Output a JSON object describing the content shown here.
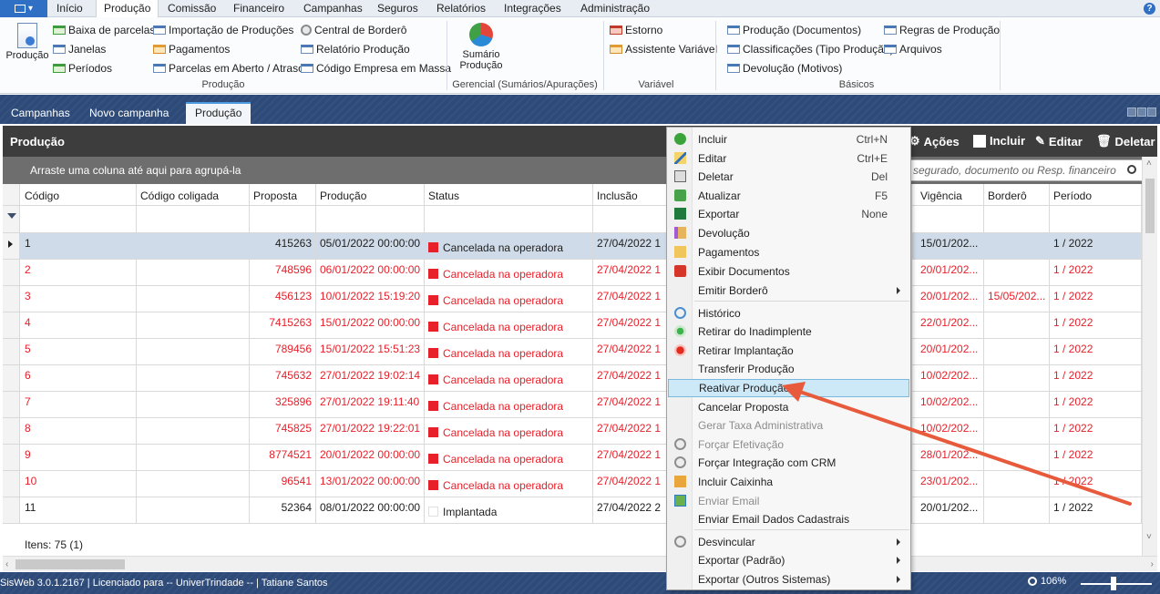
{
  "menubar": {
    "tabs": [
      "Início",
      "Produção",
      "Comissão",
      "Financeiro",
      "Campanhas",
      "Seguros",
      "Relatórios",
      "Integrações",
      "Administração"
    ],
    "active_tab": "Produção"
  },
  "ribbon": {
    "producao_big": "Produção",
    "col1": [
      "Baixa de parcelas",
      "Janelas",
      "Períodos"
    ],
    "col2": [
      "Importação de Produções",
      "Pagamentos",
      "Parcelas em Aberto / Atraso"
    ],
    "col3": [
      "Central de Borderô",
      "Relatório Produção",
      "Código Empresa em Massa"
    ],
    "group_producao": "Produção",
    "sumario_line1": "Sumário",
    "sumario_line2": "Produção",
    "group_gerencial": "Gerencial (Sumários/Apurações)",
    "variavel_items": [
      "Estorno",
      "Assistente Variável"
    ],
    "group_variavel": "Variável",
    "basicos_col1": [
      "Produção (Documentos)",
      "Classificações (Tipo Produção)",
      "Devolução (Motivos)"
    ],
    "basicos_col2": [
      "Regras de Produção",
      "Arquivos"
    ],
    "group_basicos": "Básicos"
  },
  "doc_tabs": [
    "Campanhas",
    "Novo campanha",
    "Produção"
  ],
  "panel": {
    "title": "Produção",
    "acoes": "Ações",
    "incluir": "Incluir",
    "editar": "Editar",
    "deletar": "Deletar"
  },
  "groupbar": {
    "hint": "Arraste uma coluna até aqui para agrupá-la",
    "search_placeholder": "segurado, documento ou Resp. financeiro"
  },
  "grid": {
    "columns": [
      "Código",
      "Código coligada",
      "Proposta",
      "Produção",
      "Status",
      "Inclusão",
      "Vigência",
      "Borderô",
      "Período"
    ],
    "rows": [
      {
        "codigo": "1",
        "proposta": "415263",
        "producao": "05/01/2022 00:00:00",
        "status": "Cancelada na operadora",
        "inclusao": "27/04/2022 1",
        "vigencia": "15/01/202...",
        "bordero": "",
        "periodo": "1 / 2022"
      },
      {
        "codigo": "2",
        "proposta": "748596",
        "producao": "06/01/2022 00:00:00",
        "status": "Cancelada na operadora",
        "inclusao": "27/04/2022 1",
        "vigencia": "20/01/202...",
        "bordero": "",
        "periodo": "1 / 2022"
      },
      {
        "codigo": "3",
        "proposta": "456123",
        "producao": "10/01/2022 15:19:20",
        "status": "Cancelada na operadora",
        "inclusao": "27/04/2022 1",
        "vigencia": "20/01/202...",
        "bordero": "15/05/202...",
        "periodo": "1 / 2022"
      },
      {
        "codigo": "4",
        "proposta": "7415263",
        "producao": "15/01/2022 00:00:00",
        "status": "Cancelada na operadora",
        "inclusao": "27/04/2022 1",
        "vigencia": "22/01/202...",
        "bordero": "",
        "periodo": "1 / 2022"
      },
      {
        "codigo": "5",
        "proposta": "789456",
        "producao": "15/01/2022 15:51:23",
        "status": "Cancelada na operadora",
        "inclusao": "27/04/2022 1",
        "vigencia": "20/01/202...",
        "bordero": "",
        "periodo": "1 / 2022"
      },
      {
        "codigo": "6",
        "proposta": "745632",
        "producao": "27/01/2022 19:02:14",
        "status": "Cancelada na operadora",
        "inclusao": "27/04/2022 1",
        "vigencia": "10/02/202...",
        "bordero": "",
        "periodo": "1 / 2022"
      },
      {
        "codigo": "7",
        "proposta": "325896",
        "producao": "27/01/2022 19:11:40",
        "status": "Cancelada na operadora",
        "inclusao": "27/04/2022 1",
        "vigencia": "10/02/202...",
        "bordero": "",
        "periodo": "1 / 2022"
      },
      {
        "codigo": "8",
        "proposta": "745825",
        "producao": "27/01/2022 19:22:01",
        "status": "Cancelada na operadora",
        "inclusao": "27/04/2022 1",
        "vigencia": "10/02/202...",
        "bordero": "",
        "periodo": "1 / 2022"
      },
      {
        "codigo": "9",
        "proposta": "8774521",
        "producao": "20/01/2022 00:00:00",
        "status": "Cancelada na operadora",
        "inclusao": "27/04/2022 1",
        "vigencia": "28/01/202...",
        "bordero": "",
        "periodo": "1 / 2022"
      },
      {
        "codigo": "10",
        "proposta": "96541",
        "producao": "13/01/2022 00:00:00",
        "status": "Cancelada na operadora",
        "inclusao": "27/04/2022 1",
        "vigencia": "23/01/202...",
        "bordero": "",
        "periodo": "1 / 2022"
      },
      {
        "codigo": "11",
        "proposta": "52364",
        "producao": "08/01/2022 00:00:00",
        "status": "Implantada",
        "inclusao": "27/04/2022 2",
        "vigencia": "20/01/202...",
        "bordero": "",
        "periodo": "1 / 2022"
      }
    ],
    "items_count": "Itens: 75 (1)"
  },
  "context_menu": {
    "items": [
      {
        "label": "Incluir",
        "shortcut": "Ctrl+N"
      },
      {
        "label": "Editar",
        "shortcut": "Ctrl+E"
      },
      {
        "label": "Deletar",
        "shortcut": "Del"
      },
      {
        "label": "Atualizar",
        "shortcut": "F5"
      },
      {
        "label": "Exportar",
        "shortcut": "None"
      },
      {
        "label": "Devolução",
        "shortcut": ""
      },
      {
        "label": "Pagamentos",
        "shortcut": ""
      },
      {
        "label": "Exibir Documentos",
        "shortcut": ""
      },
      {
        "label": "Emitir Borderô",
        "shortcut": ""
      },
      {
        "label": "Histórico",
        "shortcut": ""
      },
      {
        "label": "Retirar do Inadimplente",
        "shortcut": ""
      },
      {
        "label": "Retirar Implantação",
        "shortcut": ""
      },
      {
        "label": "Transferir Produção",
        "shortcut": ""
      },
      {
        "label": "Reativar Produção",
        "shortcut": ""
      },
      {
        "label": "Cancelar Proposta",
        "shortcut": ""
      },
      {
        "label": "Gerar Taxa Administrativa",
        "shortcut": ""
      },
      {
        "label": "Forçar Efetivação",
        "shortcut": ""
      },
      {
        "label": "Forçar Integração com CRM",
        "shortcut": ""
      },
      {
        "label": "Incluir Caixinha",
        "shortcut": ""
      },
      {
        "label": "Enviar Email",
        "shortcut": ""
      },
      {
        "label": "Enviar Email Dados Cadastrais",
        "shortcut": ""
      },
      {
        "label": "Desvincular",
        "shortcut": ""
      },
      {
        "label": "Exportar (Padrão)",
        "shortcut": ""
      },
      {
        "label": "Exportar (Outros Sistemas)",
        "shortcut": ""
      }
    ]
  },
  "statusbar": {
    "info": "SisWeb 3.0.1.2167 | Licenciado para -- UniverTrindade -- | Tatiane Santos",
    "zoom": "106%"
  },
  "colors": {
    "dark_blue": "#2d4a78",
    "panel_dark": "#3d3d3d",
    "red_status": "#e8202a",
    "selection": "#cfdbe8",
    "menu_highlight": "#cde8f7",
    "annotation_arrow": "#e85a3c"
  }
}
